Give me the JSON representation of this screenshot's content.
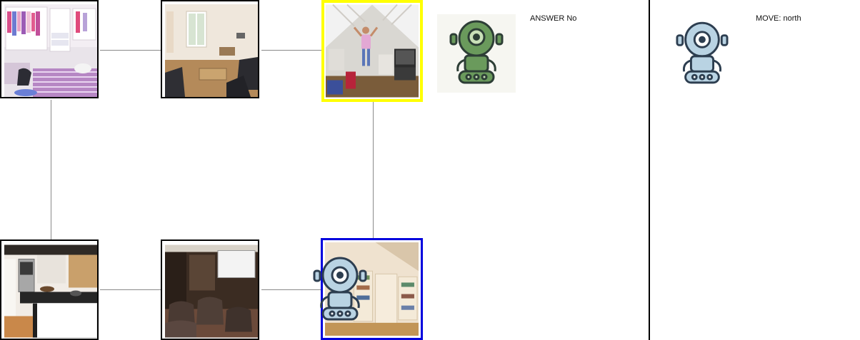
{
  "actions": {
    "answer_label": "ANSWER No",
    "move_label": "MOVE: north"
  },
  "rooms": [
    {
      "id": "r0",
      "scene": "bedroom with wardrobe and striped bed"
    },
    {
      "id": "r1",
      "scene": "living room with sofas and coffee table"
    },
    {
      "id": "r2",
      "scene": "attic room with person standing",
      "marker": "start-yellow"
    },
    {
      "id": "r3",
      "scene": "kitchen with stove and cabinets"
    },
    {
      "id": "r4",
      "scene": "home theater with recliners and screen"
    },
    {
      "id": "r5",
      "scene": "attic room with built-in bookshelves",
      "marker": "current-blue"
    }
  ],
  "agents": [
    {
      "name": "green-robot",
      "color": "#6a9a5c"
    },
    {
      "name": "blue-robot",
      "color": "#b9d3e3"
    }
  ]
}
